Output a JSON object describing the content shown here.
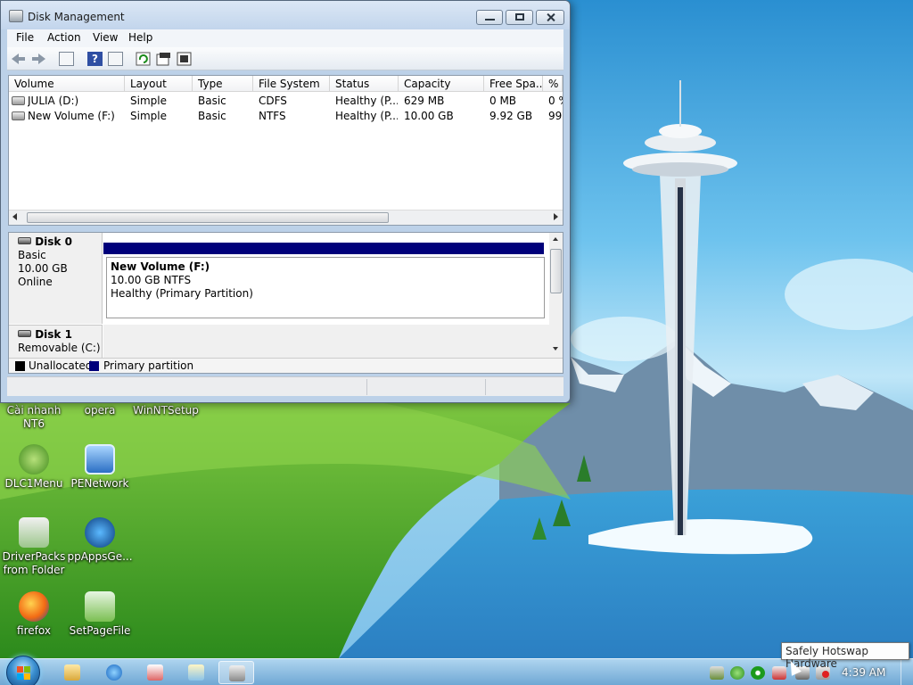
{
  "window": {
    "title": "Disk Management",
    "menu": [
      "File",
      "Action",
      "View",
      "Help"
    ]
  },
  "volume_table": {
    "columns": [
      "Volume",
      "Layout",
      "Type",
      "File System",
      "Status",
      "Capacity",
      "Free Spa...",
      "% F"
    ],
    "rows": [
      [
        "JULIA (D:)",
        "Simple",
        "Basic",
        "CDFS",
        "Healthy (P...",
        "629 MB",
        "0 MB",
        "0 %"
      ],
      [
        "New Volume (F:)",
        "Simple",
        "Basic",
        "NTFS",
        "Healthy (P...",
        "10.00 GB",
        "9.92 GB",
        "99"
      ]
    ]
  },
  "disks": [
    {
      "name": "Disk 0",
      "type": "Basic",
      "size": "10.00 GB",
      "state": "Online"
    },
    {
      "name": "Disk 1",
      "type": "Removable (C:)"
    }
  ],
  "partition": {
    "name": "New Volume  (F:)",
    "size_fs": "10.00 GB NTFS",
    "status": "Healthy (Primary Partition)"
  },
  "legend": {
    "unallocated": "Unallocated",
    "primary": "Primary partition",
    "unallocated_color": "#000000",
    "primary_color": "#00007a"
  },
  "desktop_icons": [
    {
      "label": "Cài nhanh NT6"
    },
    {
      "label": "opera"
    },
    {
      "label": "WinNTSetup"
    },
    {
      "label": "DLC1Menu"
    },
    {
      "label": "PENetwork"
    },
    {
      "label": "DriverPacks from Folder"
    },
    {
      "label": "ppAppsGe..."
    },
    {
      "label": "firefox"
    },
    {
      "label": "SetPageFile"
    }
  ],
  "taskbar": {
    "clock": "4:39 AM",
    "tooltip": "Safely Hotswap Hardware"
  }
}
